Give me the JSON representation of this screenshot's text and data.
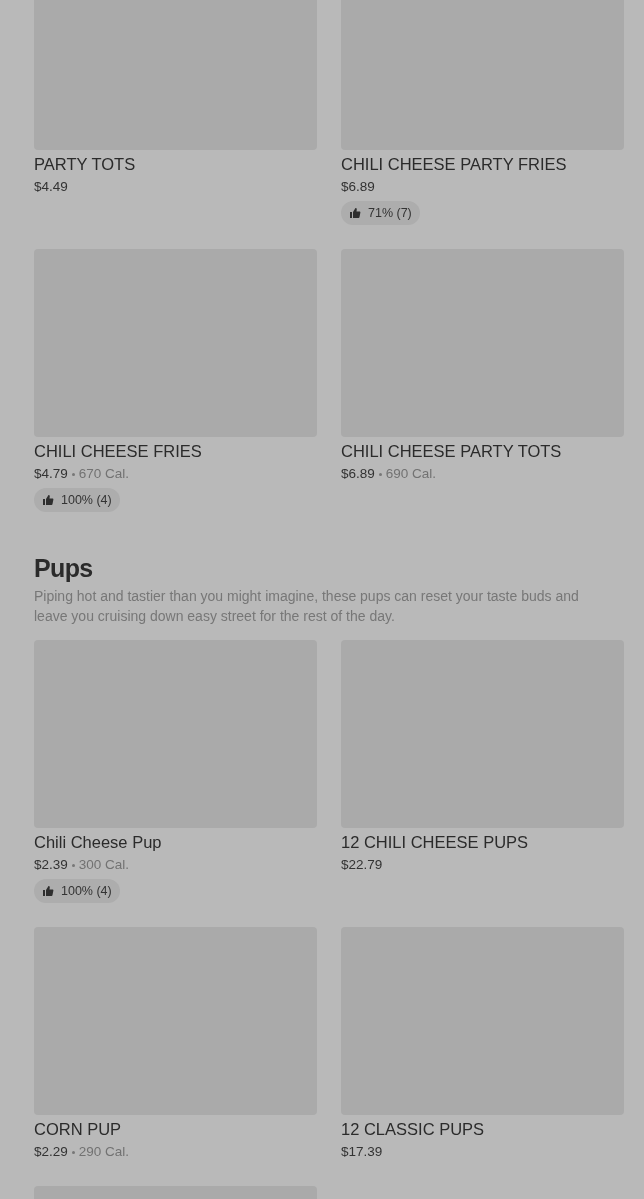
{
  "sections": [
    {
      "items": [
        {
          "name": "PARTY TOTS",
          "price": "$4.49"
        },
        {
          "name": "CHILI CHEESE PARTY FRIES",
          "price": "$6.89",
          "rating": "71% (7)"
        },
        {
          "name": "CHILI CHEESE FRIES",
          "price": "$4.79",
          "calories": "670 Cal.",
          "rating": "100% (4)"
        },
        {
          "name": "CHILI CHEESE PARTY TOTS",
          "price": "$6.89",
          "calories": "690 Cal."
        }
      ]
    },
    {
      "title": "Pups",
      "description": "Piping hot and tastier than you might imagine, these pups can reset your taste buds and leave you cruising down easy street for the rest of the day.",
      "more_below": true,
      "items": [
        {
          "name": "Chili Cheese Pup",
          "price": "$2.39",
          "calories": "300 Cal.",
          "rating": "100% (4)"
        },
        {
          "name": "12 CHILI CHEESE PUPS",
          "price": "$22.79"
        },
        {
          "name": "CORN PUP",
          "price": "$2.29",
          "calories": "290 Cal."
        },
        {
          "name": "12 CLASSIC PUPS",
          "price": "$17.39"
        }
      ]
    }
  ]
}
